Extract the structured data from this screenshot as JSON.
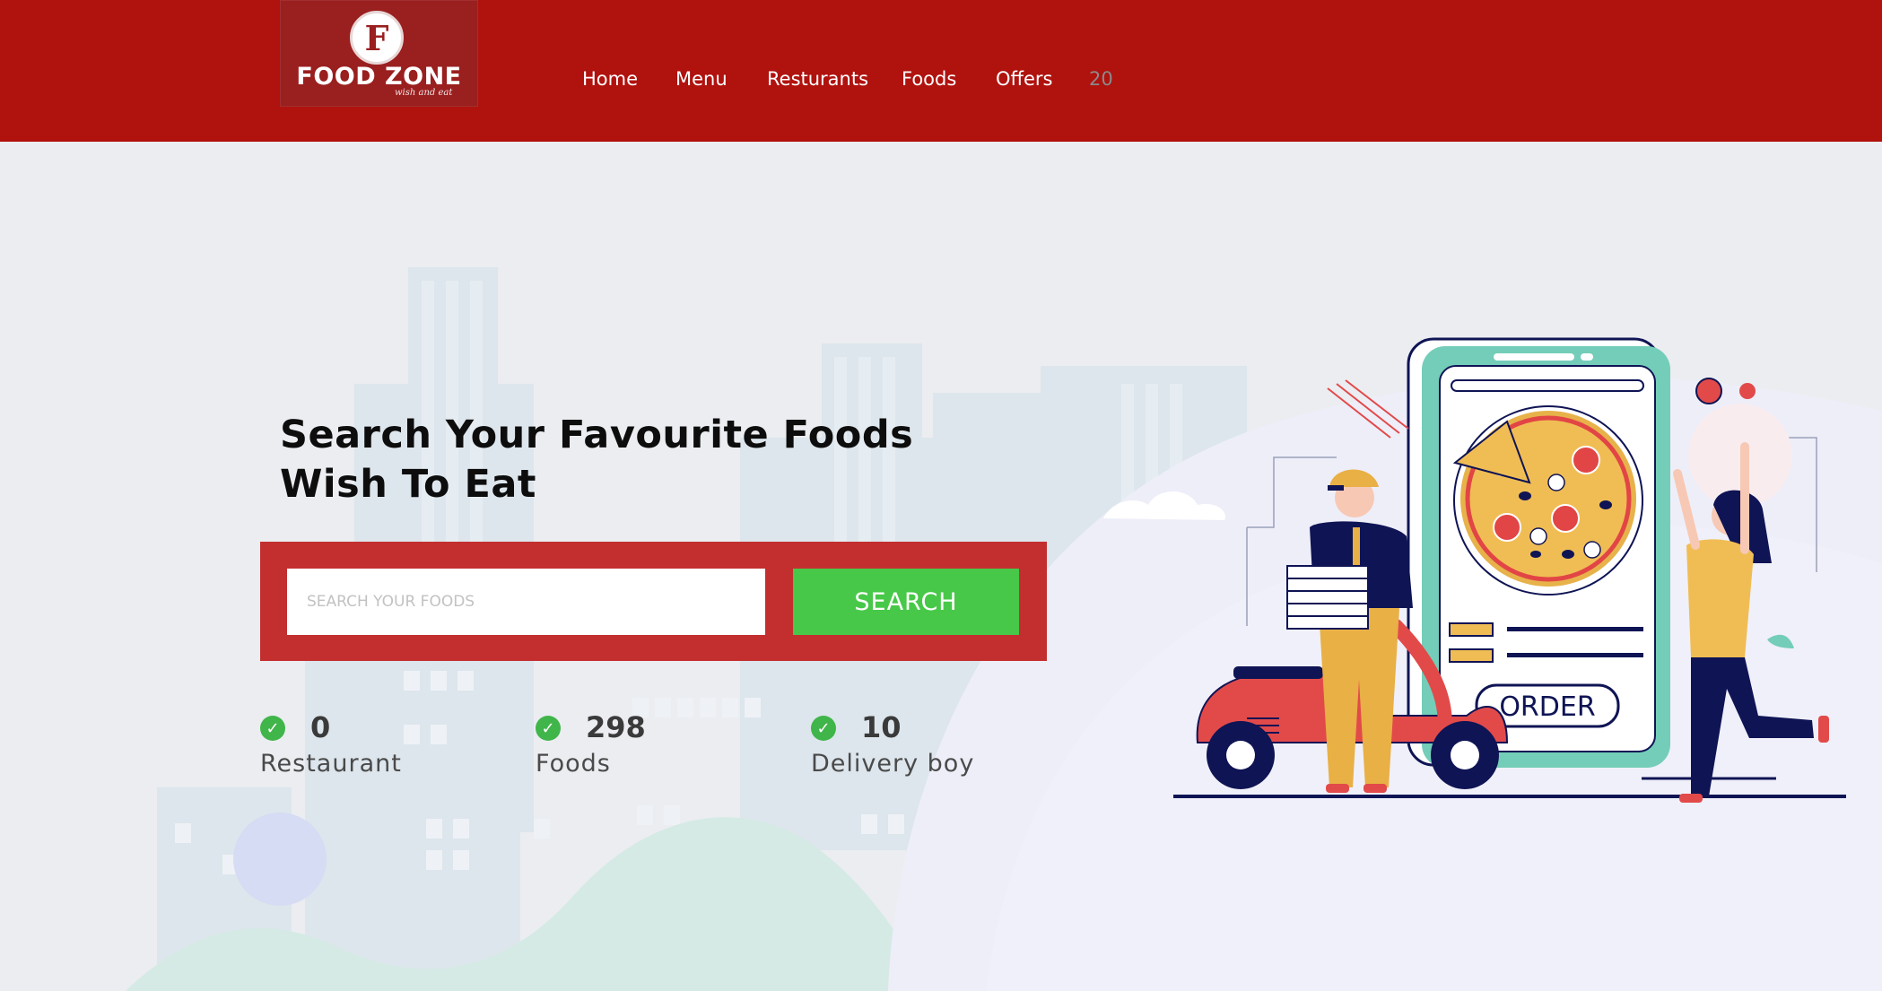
{
  "brand": {
    "logo_letter": "F",
    "name": "FOOD ZONE",
    "tagline": "wish and eat"
  },
  "nav": {
    "items": [
      "Home",
      "Menu",
      "Resturants",
      "Foods",
      "Offers"
    ],
    "counter": "20"
  },
  "hero": {
    "headline_line1": "Search Your Favourite Foods",
    "headline_line2": "Wish To Eat"
  },
  "search": {
    "placeholder": "SEARCH YOUR FOODS",
    "value": "",
    "button_label": "SEARCH"
  },
  "stats": [
    {
      "value": "0",
      "label": "Restaurant"
    },
    {
      "value": "298",
      "label": "Foods"
    },
    {
      "value": "10",
      "label": "Delivery boy"
    }
  ],
  "illustration": {
    "order_label": "ORDER"
  },
  "colors": {
    "header_bg": "#b0120e",
    "search_panel": "#c32f2f",
    "search_button": "#48c849",
    "check": "#40b54a",
    "page_bg": "#ebedf1"
  }
}
